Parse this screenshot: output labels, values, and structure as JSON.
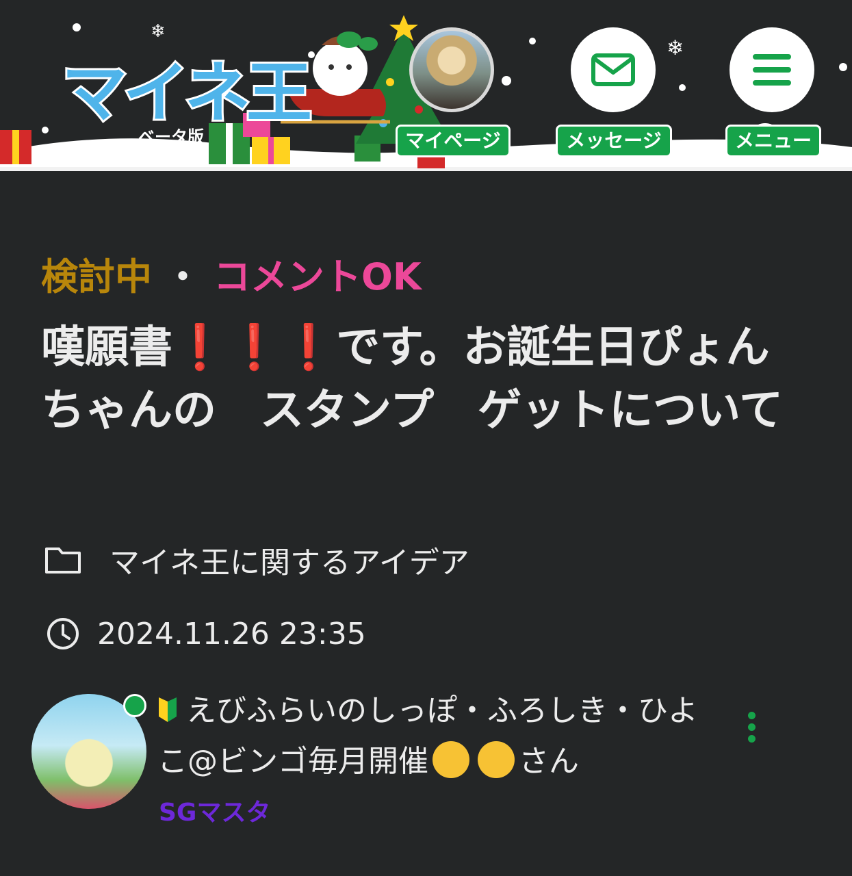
{
  "header": {
    "logo": {
      "text": "マイネ王",
      "subtitle": "ベータ版"
    },
    "nav": [
      {
        "label": "マイページ",
        "icon": "user-avatar"
      },
      {
        "label": "メッセージ",
        "icon": "mail-icon"
      },
      {
        "label": "メニュー",
        "icon": "hamburger-menu-icon"
      }
    ],
    "colors": {
      "accent": "#16a34a",
      "logo_blue": "#4fb4ea",
      "logo_yellow": "#ffd21f"
    }
  },
  "post": {
    "status": "検討中",
    "separator": "・",
    "comment_status": "コメントOK",
    "title_start": "嘆願書",
    "title_marks": [
      "❗",
      "❗",
      "❗"
    ],
    "title_end": "です。お誕生日ぴょんちゃんの　スタンプ　ゲットについて",
    "category": {
      "icon": "folder-icon",
      "label": "マイネ王に関するアイデア"
    },
    "date": {
      "icon": "clock-icon",
      "label": "2024.11.26 23:35"
    },
    "author": {
      "badge_icon": "beginner-mark-icon",
      "name_part1": "えびふらいのしっぽ・ふろしき・ひよこ@ビンゴ毎月開催",
      "emoji1": "grinning-sweat-emoji",
      "emoji2": "hand-over-mouth-emoji",
      "suffix": "さん",
      "role": "SGマスタ"
    },
    "colors": {
      "status": "#b8860b",
      "comment_ok": "#ec4899",
      "exclamation": "#d41c1c",
      "role": "#6d28d9"
    }
  }
}
